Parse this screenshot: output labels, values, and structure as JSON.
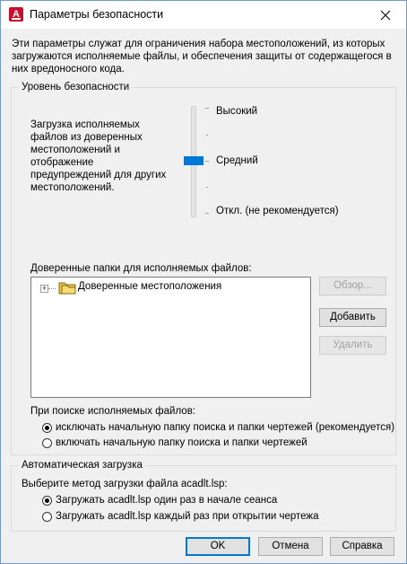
{
  "window": {
    "title": "Параметры безопасности",
    "close_icon": "close-icon"
  },
  "intro": "Эти параметры служат для ограничения набора местоположений, из которых загружаются исполняемые файлы, и обеспечения защиты от содержащегося в них вредоносного кода.",
  "security_level": {
    "group_label": "Уровень безопасности",
    "description": "Загрузка исполняемых файлов из доверенных местоположений и отображение предупреждений для других местоположений.",
    "levels": [
      "Высокий",
      "Средний",
      "Откл. (не рекомендуется)"
    ],
    "selected": "Средний"
  },
  "trusted": {
    "label": "Доверенные папки для исполняемых файлов:",
    "tree_item": "Доверенные местоположения",
    "browse": "Обзор...",
    "add": "Добавить",
    "remove": "Удалить"
  },
  "search": {
    "label": "При поиске исполняемых файлов:",
    "options": [
      "исключать начальную папку поиска и папки чертежей (рекомендуется)",
      "включать начальную папку поиска и папки чертежей"
    ],
    "selected_index": 0
  },
  "autoload": {
    "group_label": "Автоматическая загрузка",
    "label": "Выберите метод загрузки файла acadlt.lsp:",
    "options": [
      "Загружать acadlt.lsp один раз в начале сеанса",
      "Загружать acadlt.lsp каждый раз при открытии чертежа"
    ],
    "selected_index": 0
  },
  "footer": {
    "ok": "OK",
    "cancel": "Отмена",
    "help": "Справка"
  }
}
